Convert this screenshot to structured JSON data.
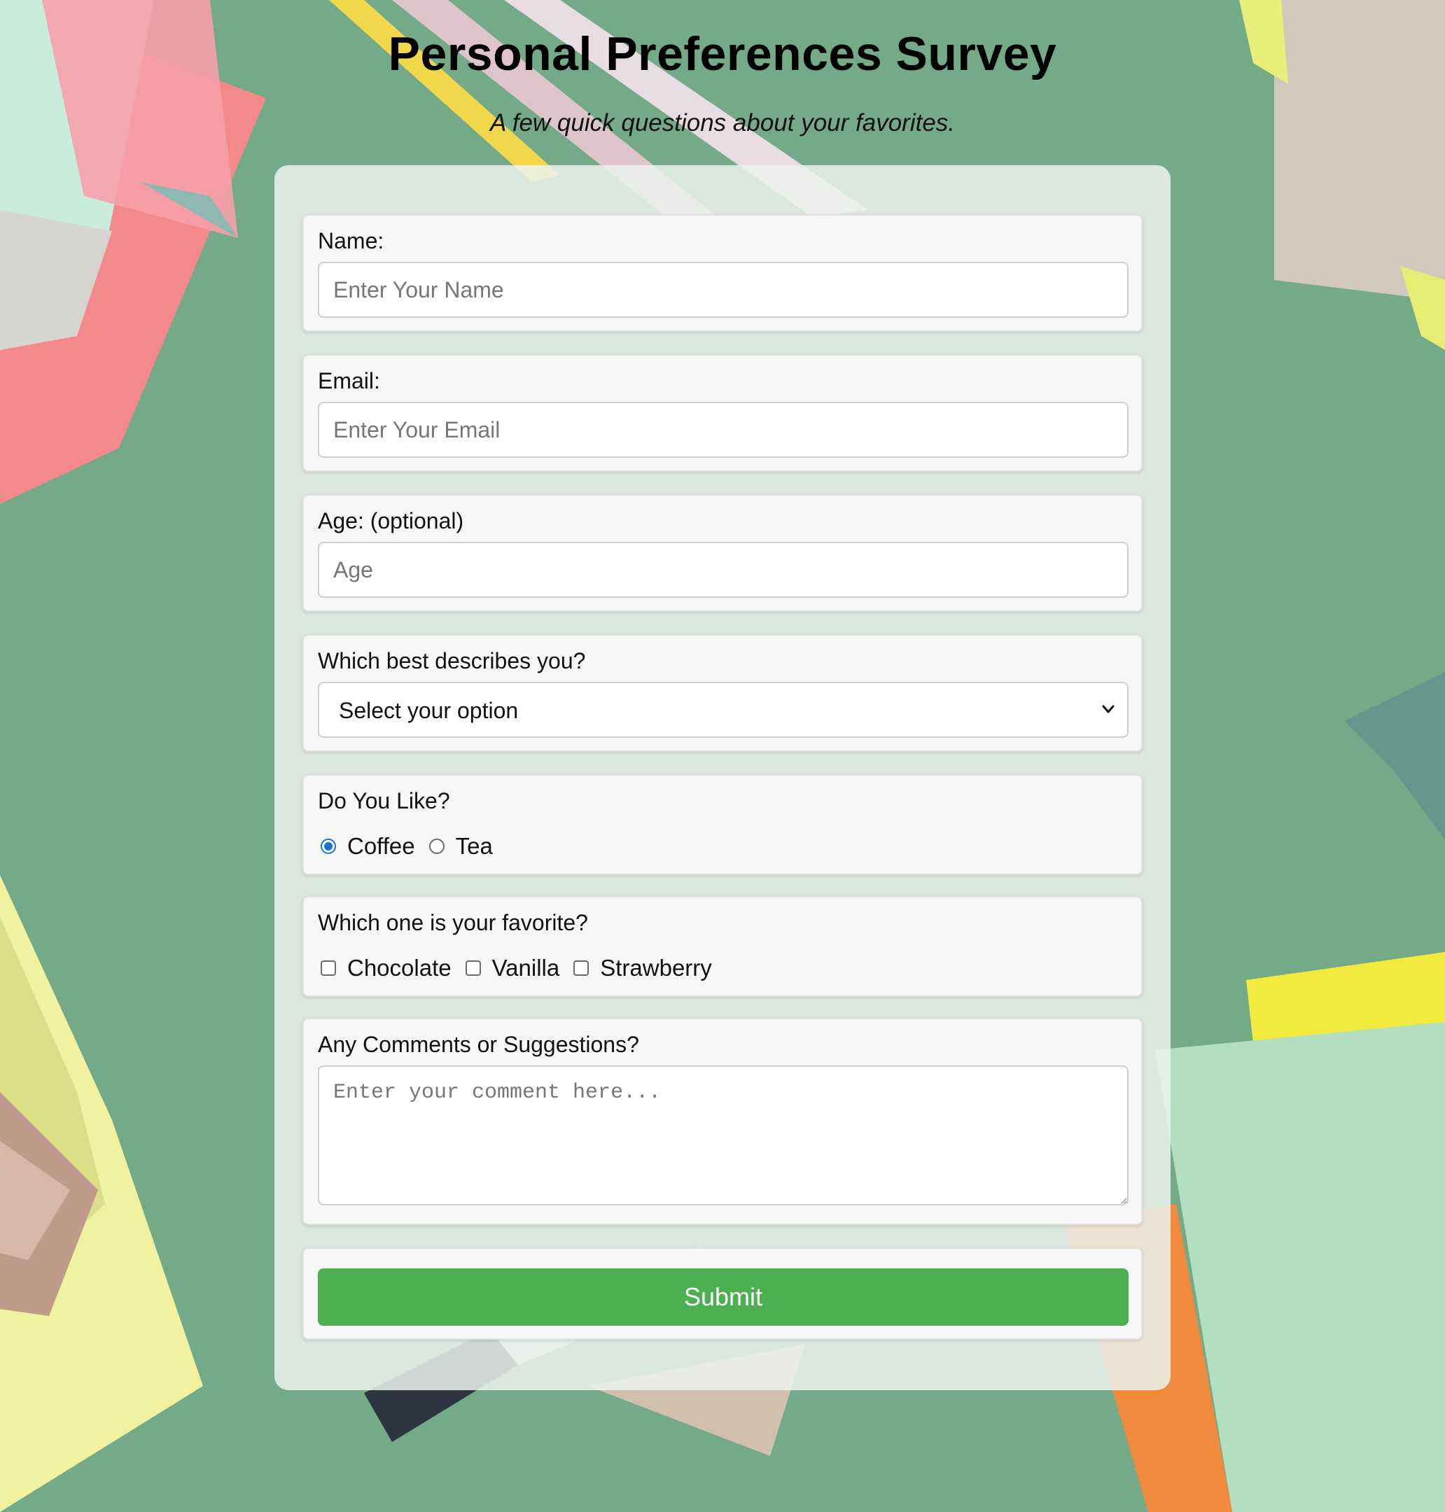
{
  "header": {
    "title": "Personal Preferences Survey",
    "subtitle": "A few quick questions about your favorites."
  },
  "form": {
    "name": {
      "label": "Name:",
      "placeholder": "Enter Your Name",
      "value": ""
    },
    "email": {
      "label": "Email:",
      "placeholder": "Enter Your Email",
      "value": ""
    },
    "age": {
      "label": "Age: (optional)",
      "placeholder": "Age",
      "value": ""
    },
    "describe": {
      "label": "Which best describes you?",
      "selected": "Select your option",
      "icon": "chevron-down-icon"
    },
    "drink": {
      "label": "Do You Like?",
      "options": [
        {
          "label": "Coffee",
          "checked": true
        },
        {
          "label": "Tea",
          "checked": false
        }
      ]
    },
    "favorite": {
      "label": "Which one is your favorite?",
      "options": [
        {
          "label": "Chocolate",
          "checked": false
        },
        {
          "label": "Vanilla",
          "checked": false
        },
        {
          "label": "Strawberry",
          "checked": false
        }
      ]
    },
    "comments": {
      "label": "Any Comments or Suggestions?",
      "placeholder": "Enter your comment here...",
      "value": ""
    },
    "submit_label": "Submit"
  },
  "colors": {
    "accent": "#4caf50",
    "radio_checked": "#1a73d9",
    "background": "#7aae8c"
  }
}
